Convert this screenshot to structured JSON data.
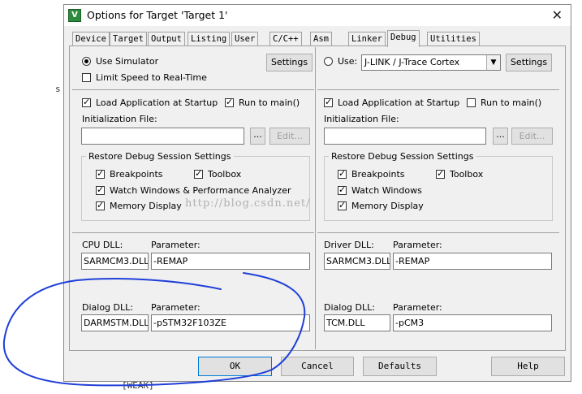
{
  "window": {
    "title": "Options for Target 'Target 1'",
    "close_glyph": "✕",
    "app_icon_glyph": "V"
  },
  "background": {
    "left_char": "s",
    "bottom_text": "[WEAK]"
  },
  "tabs": [
    {
      "label": "Device"
    },
    {
      "label": "Target"
    },
    {
      "label": "Output"
    },
    {
      "label": "Listing"
    },
    {
      "label": "User"
    },
    {
      "label": "C/C++"
    },
    {
      "label": "Asm"
    },
    {
      "label": "Linker"
    },
    {
      "label": "Debug",
      "active": true
    },
    {
      "label": "Utilities"
    }
  ],
  "left": {
    "use_simulator": {
      "label": "Use Simulator",
      "checked": true
    },
    "limit_speed": {
      "label": "Limit Speed to Real-Time",
      "checked": false
    },
    "settings_button": "Settings",
    "load_app": {
      "label": "Load Application at Startup",
      "checked": true
    },
    "run_to_main": {
      "label": "Run to main()",
      "checked": true
    },
    "init_file_label": "Initialization File:",
    "init_file_value": "",
    "browse_button": "...",
    "edit_button": "Edit...",
    "restore_group": "Restore Debug Session Settings",
    "breakpoints": {
      "label": "Breakpoints",
      "checked": true
    },
    "toolbox": {
      "label": "Toolbox",
      "checked": true
    },
    "watch": {
      "label": "Watch Windows & Performance Analyzer",
      "checked": true
    },
    "memory": {
      "label": "Memory Display",
      "checked": true
    },
    "cpu_dll_label": "CPU DLL:",
    "cpu_param_label": "Parameter:",
    "cpu_dll_value": "SARMCM3.DLL",
    "cpu_param_value": "-REMAP",
    "dialog_dll_label": "Dialog DLL:",
    "dialog_param_label": "Parameter:",
    "dialog_dll_value": "DARMSTM.DLL",
    "dialog_param_value": "-pSTM32F103ZE"
  },
  "right": {
    "use": {
      "label": "Use:",
      "checked": false
    },
    "debugger_select": "J-LINK / J-Trace Cortex",
    "settings_button": "Settings",
    "load_app": {
      "label": "Load Application at Startup",
      "checked": true
    },
    "run_to_main": {
      "label": "Run to main()",
      "checked": false
    },
    "init_file_label": "Initialization File:",
    "init_file_value": "",
    "browse_button": "...",
    "edit_button": "Edit...",
    "restore_group": "Restore Debug Session Settings",
    "breakpoints": {
      "label": "Breakpoints",
      "checked": true
    },
    "toolbox": {
      "label": "Toolbox",
      "checked": true
    },
    "watch": {
      "label": "Watch Windows",
      "checked": true
    },
    "memory": {
      "label": "Memory Display",
      "checked": true
    },
    "driver_dll_label": "Driver DLL:",
    "driver_param_label": "Parameter:",
    "driver_dll_value": "SARMCM3.DLL",
    "driver_param_value": "-REMAP",
    "dialog_dll_label": "Dialog DLL:",
    "dialog_param_label": "Parameter:",
    "dialog_dll_value": "TCM.DLL",
    "dialog_param_value": "-pCM3"
  },
  "footer": {
    "ok": "OK",
    "cancel": "Cancel",
    "defaults": "Defaults",
    "help": "Help"
  },
  "watermark": "http://blog.csdn.net/",
  "colors": {
    "annotation": "#1f3fd8",
    "dialog_bg": "#f0f0f0",
    "icon_green": "#2e8b3e"
  }
}
